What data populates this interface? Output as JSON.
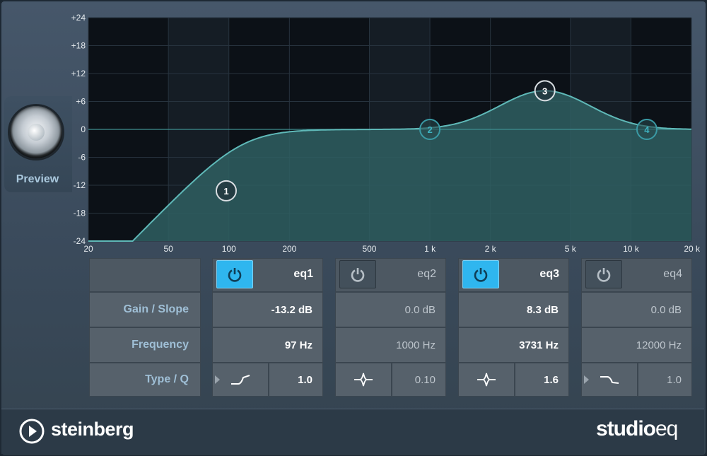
{
  "preview": {
    "label": "Preview"
  },
  "graph": {
    "y_ticks": [
      "+24",
      "+18",
      "+12",
      "+6",
      "0",
      "-6",
      "-12",
      "-18",
      "-24"
    ],
    "x_ticks": [
      "20",
      "50",
      "100",
      "200",
      "500",
      "1 k",
      "2 k",
      "5 k",
      "10 k",
      "20 k"
    ],
    "nodes": [
      {
        "label": "1",
        "freq": 97,
        "gain": -13.2,
        "active": true
      },
      {
        "label": "2",
        "freq": 1000,
        "gain": 0.0,
        "active": false
      },
      {
        "label": "3",
        "freq": 3731,
        "gain": 8.3,
        "active": true
      },
      {
        "label": "4",
        "freq": 12000,
        "gain": 0.0,
        "active": false
      }
    ],
    "colors": {
      "curve": "#5fb9b8",
      "fill": "#2f5f62",
      "active_node": "#ffffff",
      "inactive_node": "#3fb4c2"
    }
  },
  "row_labels": {
    "gain": "Gain / Slope",
    "frequency": "Frequency",
    "type": "Type / Q"
  },
  "bands": [
    {
      "name": "eq1",
      "enabled": true,
      "gain": "-13.2 dB",
      "frequency": "97 Hz",
      "type_icon": "low-cut-icon",
      "q": "1.0"
    },
    {
      "name": "eq2",
      "enabled": false,
      "gain": "0.0 dB",
      "frequency": "1000 Hz",
      "type_icon": "peak-filter-icon",
      "q": "0.10"
    },
    {
      "name": "eq3",
      "enabled": true,
      "gain": "8.3 dB",
      "frequency": "3731 Hz",
      "type_icon": "peak-filter-icon",
      "q": "1.6"
    },
    {
      "name": "eq4",
      "enabled": false,
      "gain": "0.0 dB",
      "frequency": "12000 Hz",
      "type_icon": "high-cut-icon",
      "q": "1.0"
    }
  ],
  "footer": {
    "brand": "steinberg",
    "product_bold": "studio",
    "product_light": "eq"
  },
  "accent_color": "#2fb6ef"
}
